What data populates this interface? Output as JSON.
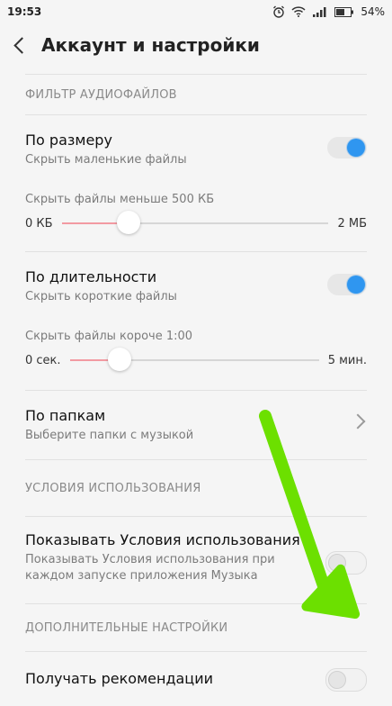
{
  "status": {
    "time": "19:53",
    "battery": "54%"
  },
  "appbar": {
    "title": "Аккаунт и настройки"
  },
  "sections": {
    "filter_header": "ФИЛЬТР АУДИОФАЙЛОВ",
    "terms_header": "УСЛОВИЯ ИСПОЛЬЗОВАНИЯ",
    "extra_header": "ДОПОЛНИТЕЛЬНЫЕ НАСТРОЙКИ"
  },
  "size_filter": {
    "title": "По размеру",
    "subtitle": "Скрыть маленькие файлы",
    "toggle_on": true,
    "slider_label": "Скрыть файлы меньше 500 КБ",
    "min_label": "0 КБ",
    "max_label": "2 МБ",
    "value_fraction": 0.25
  },
  "duration_filter": {
    "title": "По длительности",
    "subtitle": "Скрыть короткие файлы",
    "toggle_on": true,
    "slider_label": "Скрыть файлы короче 1:00",
    "min_label": "0 сек.",
    "max_label": "5 мин.",
    "value_fraction": 0.2
  },
  "folders": {
    "title": "По папкам",
    "subtitle": "Выберите папки с музыкой"
  },
  "terms": {
    "title": "Показывать Условия использования",
    "subtitle": "Показывать Условия использования при каждом запуске приложения Музыка",
    "toggle_on": false
  },
  "recommendations": {
    "title": "Получать рекомендации",
    "toggle_on": false
  },
  "colors": {
    "accent": "#2f96f0",
    "slider_fill": "#f29aa2",
    "arrow": "#6ce000"
  },
  "icons": [
    "alarm-icon",
    "wifi-icon",
    "signal-icon",
    "battery-icon",
    "back-arrow-icon",
    "chevron-right-icon"
  ]
}
